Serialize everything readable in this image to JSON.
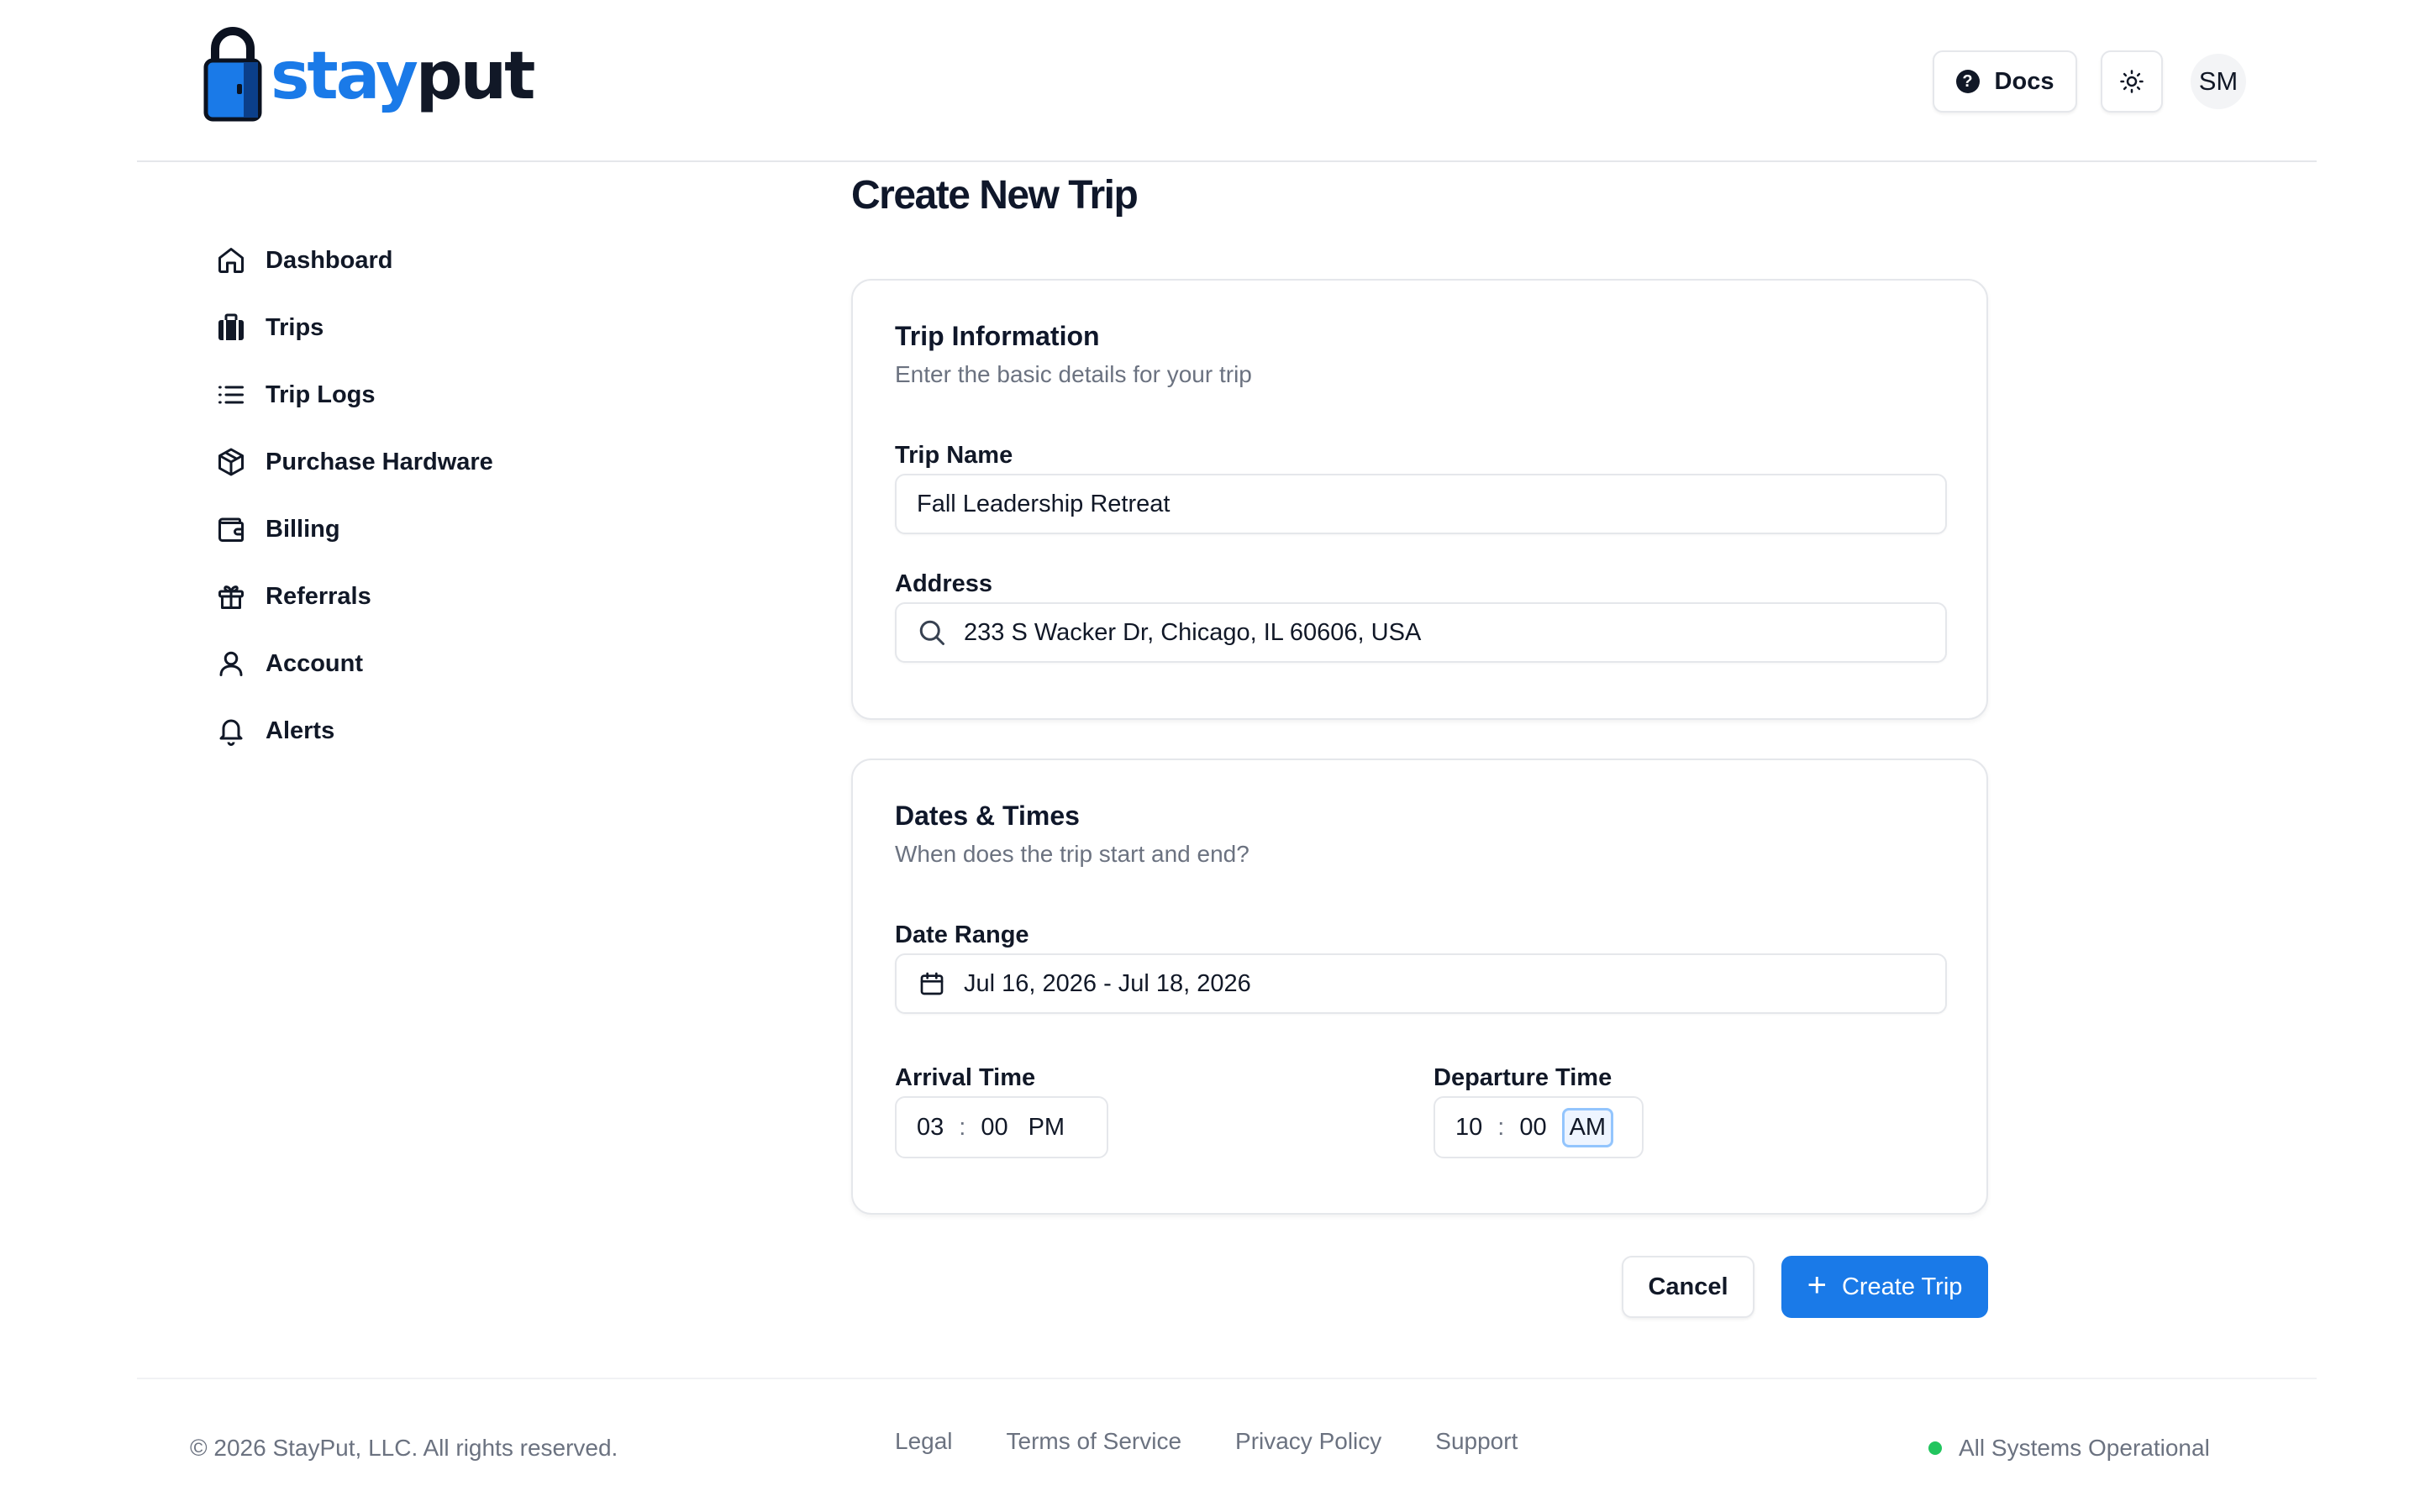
{
  "brand": {
    "name_part1": "stay",
    "name_part2": "put",
    "accent_color": "#1a7ae8"
  },
  "header": {
    "docs_label": "Docs",
    "docs_icon": "help-circle-icon",
    "theme_icon": "sun-icon",
    "avatar_initials": "SM"
  },
  "sidebar": {
    "items": [
      {
        "label": "Dashboard",
        "icon": "home-icon"
      },
      {
        "label": "Trips",
        "icon": "luggage-icon"
      },
      {
        "label": "Trip Logs",
        "icon": "list-icon"
      },
      {
        "label": "Purchase Hardware",
        "icon": "package-icon"
      },
      {
        "label": "Billing",
        "icon": "wallet-icon"
      },
      {
        "label": "Referrals",
        "icon": "gift-icon"
      },
      {
        "label": "Account",
        "icon": "user-icon"
      },
      {
        "label": "Alerts",
        "icon": "bell-icon"
      }
    ]
  },
  "main": {
    "page_title": "Create New Trip",
    "trip_info": {
      "title": "Trip Information",
      "subtitle": "Enter the basic details for your trip",
      "trip_name_label": "Trip Name",
      "trip_name_value": "Fall Leadership Retreat",
      "address_label": "Address",
      "address_value": "233 S Wacker Dr, Chicago, IL 60606, USA"
    },
    "dates_times": {
      "title": "Dates & Times",
      "subtitle": "When does the trip start and end?",
      "date_range_label": "Date Range",
      "date_range_value": "Jul 16, 2026 - Jul 18, 2026",
      "arrival_label": "Arrival Time",
      "arrival": {
        "hour": "03",
        "sep": ":",
        "minute": "00",
        "period": "PM"
      },
      "departure_label": "Departure Time",
      "departure": {
        "hour": "10",
        "sep": ":",
        "minute": "00",
        "period": "AM"
      }
    },
    "actions": {
      "cancel_label": "Cancel",
      "create_label": "Create Trip",
      "create_icon": "plus-icon"
    }
  },
  "footer": {
    "copyright": "© 2026 StayPut, LLC. All rights reserved.",
    "links": [
      "Legal",
      "Terms of Service",
      "Privacy Policy",
      "Support"
    ],
    "status_text": "All Systems Operational",
    "status_color": "#22c55e"
  }
}
